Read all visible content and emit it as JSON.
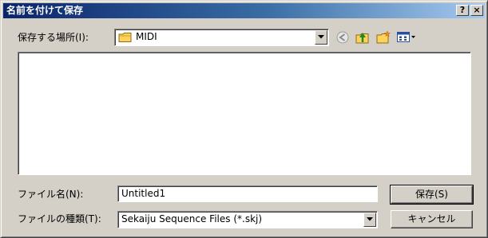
{
  "window": {
    "title": "名前を付けて保存",
    "help_button": "?",
    "close_button": "×"
  },
  "location": {
    "label": "保存する場所(I):",
    "value": "MIDI"
  },
  "toolbar": {
    "back_icon": "back-arrow-icon",
    "up_icon": "up-folder-icon",
    "new_folder_icon": "new-folder-icon",
    "view_menu_icon": "view-menu-icon"
  },
  "filename": {
    "label": "ファイル名(N):",
    "value": "Untitled1"
  },
  "filetype": {
    "label": "ファイルの種類(T):",
    "value": "Sekaiju Sequence Files (*.skj)"
  },
  "buttons": {
    "save": "保存(S)",
    "cancel": "キャンセル"
  },
  "colors": {
    "title_start": "#0a246a",
    "title_end": "#a6caf0",
    "face": "#d4d0c8",
    "folder": "#ffd35b"
  }
}
